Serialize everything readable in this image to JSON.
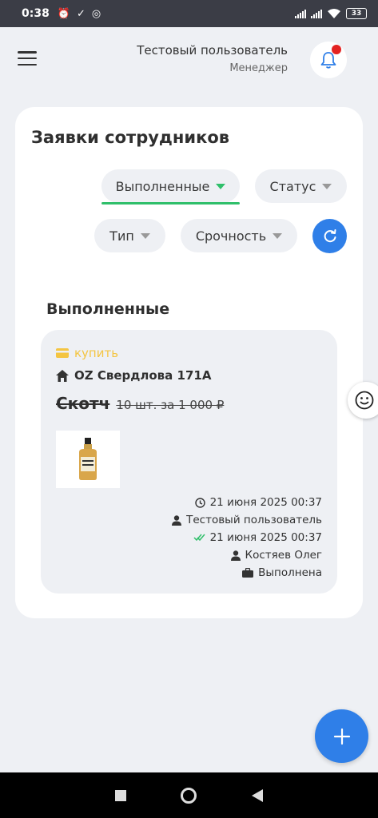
{
  "status_bar": {
    "time": "0:38",
    "battery": "33"
  },
  "header": {
    "user_name": "Тестовый пользователь",
    "user_role": "Менеджер"
  },
  "page": {
    "title": "Заявки сотрудников",
    "filters": {
      "done_tab": "Выполненные",
      "status": "Статус",
      "type": "Тип",
      "urgency": "Срочность"
    },
    "section_title": "Выполненные"
  },
  "request": {
    "type_label": "купить",
    "address": "OZ Свердлова 171А",
    "item_name": "Скотч",
    "quantity_text": "10 шт. за 1 000 ₽",
    "created_at": "21 июня 2025 00:37",
    "created_by": "Тестовый пользователь",
    "completed_at": "21 июня 2025 00:37",
    "assignee": "Костяев Олег",
    "status": "Выполнена"
  },
  "colors": {
    "accent_blue": "#2f7fe8",
    "active_green": "#2fbf6a",
    "type_yellow": "#f4c542",
    "notification_red": "#e32222"
  }
}
